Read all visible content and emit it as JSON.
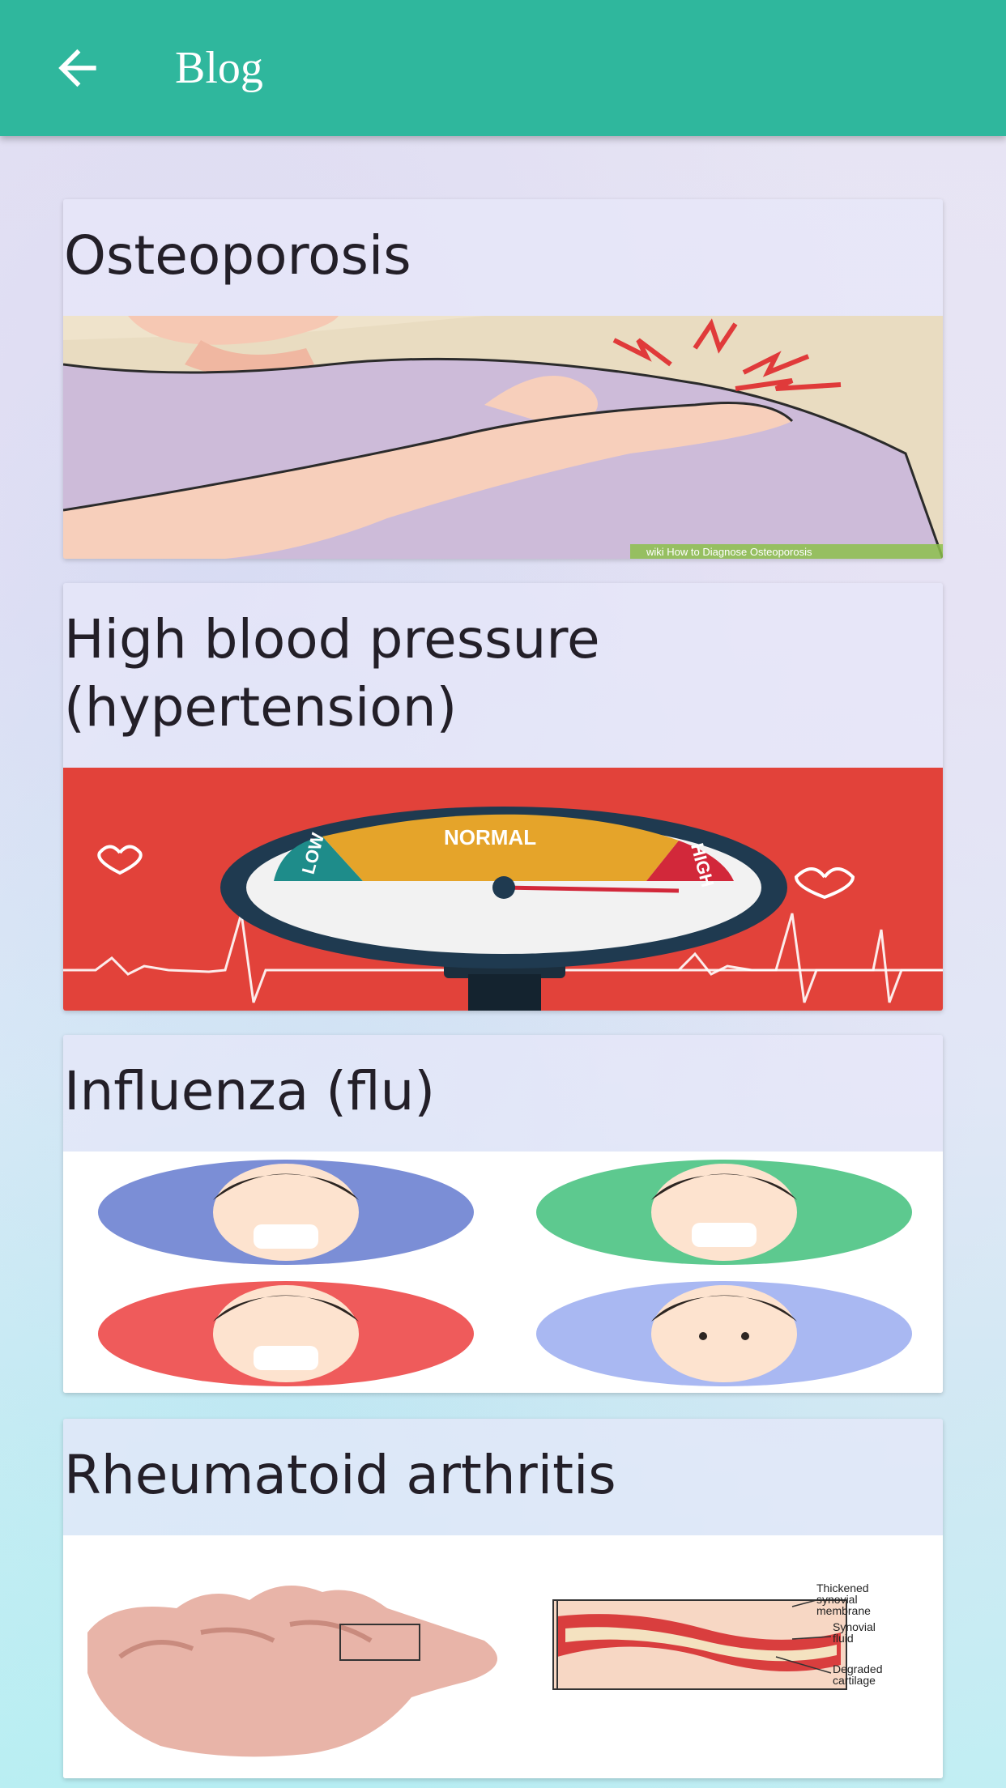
{
  "appbar": {
    "title": "Blog",
    "back_icon": "arrow-left-icon"
  },
  "colors": {
    "appbar": "#2fb79d",
    "title_text": "#ffffff",
    "card_text": "#231f28"
  },
  "posts": [
    {
      "title": "Osteoporosis",
      "image": "shoulder-pain-illustration",
      "image_caption": "wiki How to Diagnose Osteoporosis"
    },
    {
      "title_line1": "High blood pressure",
      "title_line2": "(hypertension)",
      "image": "blood-pressure-gauge-illustration",
      "gauge_labels": {
        "low": "LOW",
        "normal": "NORMAL",
        "high": "HIGH"
      }
    },
    {
      "title": "Influenza (flu)",
      "image": "flu-symptoms-children-illustration"
    },
    {
      "title": "Rheumatoid arthritis",
      "image": "arthritis-hand-joint-illustration",
      "diagram_labels": {
        "membrane_1": "Thickened",
        "membrane_2": "synovial",
        "membrane_3": "membrane",
        "fluid_1": "Synovial",
        "fluid_2": "fluid",
        "cartilage_1": "Degraded",
        "cartilage_2": "cartilage"
      }
    }
  ]
}
